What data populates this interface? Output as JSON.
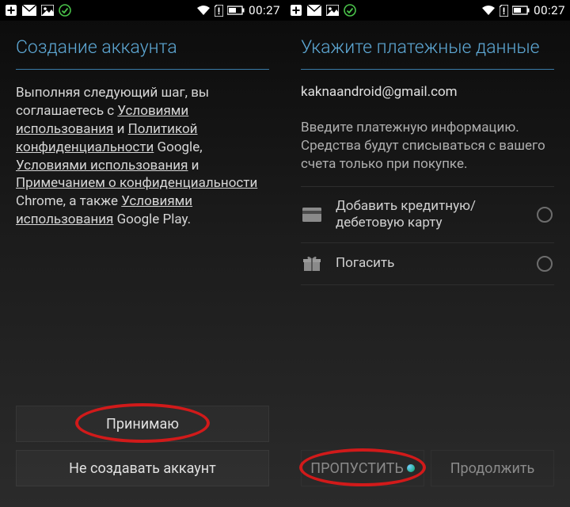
{
  "statusbar": {
    "time": "00:27"
  },
  "left": {
    "title": "Создание аккаунта",
    "body": {
      "part1": "Выполняя следующий шаг, вы соглашаетесь с ",
      "link1": "Условиями использования",
      "and1": " и ",
      "link2": "Политикой конфиденциальности",
      "afterLink2": " Google, ",
      "link3": "Условиями использования",
      "and2": " и ",
      "link4": "Примечанием о конфиденциальности",
      "afterLink4": " Chrome, а также ",
      "link5": "Условиями использования",
      "afterLink5": " Google Play."
    },
    "buttons": {
      "accept": "Принимаю",
      "dont_create": "Не создавать аккаунт"
    }
  },
  "right": {
    "title": "Укажите платежные данные",
    "email": "kaknaandroid@gmail.com",
    "info": "Введите платежную информацию. Средства будут списываться с вашего счета только при покупке.",
    "options": {
      "card": "Добавить кредитную/дебетовую карту",
      "redeem": "Погасить"
    },
    "buttons": {
      "skip": "ПРОПУСТИТЬ",
      "continue": "Продолжить"
    }
  }
}
